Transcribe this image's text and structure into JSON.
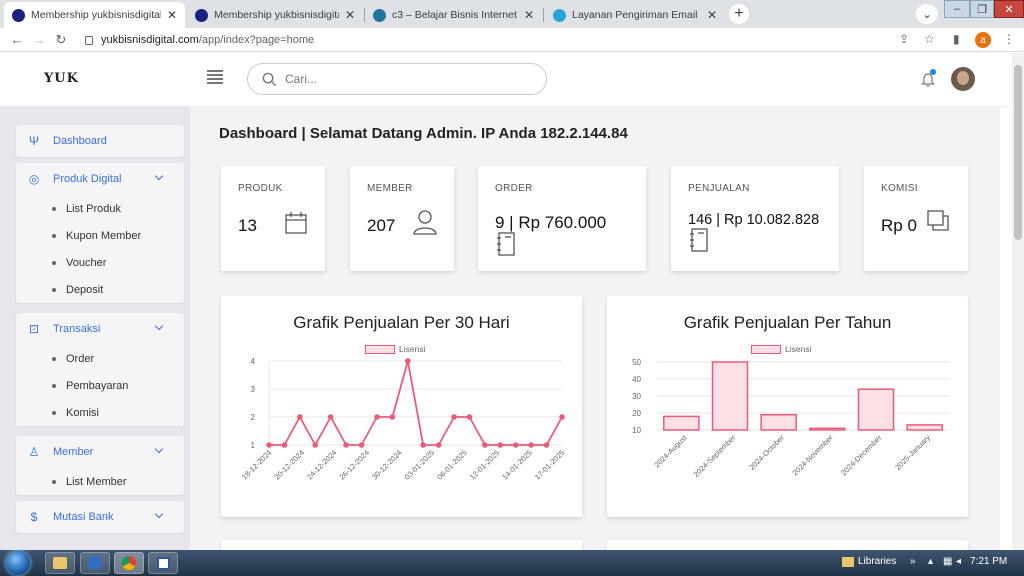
{
  "browser": {
    "tabs": [
      {
        "title": "Membership yukbisnisdigital.com",
        "color": "#1a237e",
        "glyph": "M"
      },
      {
        "title": "Membership yukbisnisdigital.com",
        "color": "#1a237e",
        "glyph": "M"
      },
      {
        "title": "c3 – Belajar Bisnis Internet",
        "color": "#21759b",
        "glyph": "W"
      },
      {
        "title": "Layanan Pengiriman Email Marke",
        "color": "#2aa3d9",
        "glyph": "➤"
      }
    ],
    "url_host": "yukbisnisdigital.com",
    "url_path": "/app/index?page=home",
    "profile_letter": "a"
  },
  "header": {
    "logo": "YUK",
    "search_placeholder": "Cari..."
  },
  "sidebar": {
    "dashboard": "Dashboard",
    "produk_digital": {
      "label": "Produk Digital",
      "items": [
        "List Produk",
        "Kupon Member",
        "Voucher",
        "Deposit"
      ]
    },
    "transaksi": {
      "label": "Transaksi",
      "items": [
        "Order",
        "Pembayaran",
        "Komisi"
      ]
    },
    "member": {
      "label": "Member",
      "items": [
        "List Member"
      ]
    },
    "mutasi_bank": "Mutasi Bank"
  },
  "main": {
    "title": "Dashboard | Selamat Datang Admin. IP Anda 182.2.144.84",
    "stats": {
      "produk": {
        "label": "PRODUK",
        "value": "13"
      },
      "member": {
        "label": "MEMBER",
        "value": "207"
      },
      "order": {
        "label": "ORDER",
        "value": "9 | Rp 760.000"
      },
      "penjualan": {
        "label": "PENJUALAN",
        "value": "146 | Rp 10.082.828"
      },
      "komisi": {
        "label": "KOMISI",
        "value": "Rp 0"
      }
    }
  },
  "chart_data": [
    {
      "type": "line",
      "title": "Grafik Penjualan Per 30 Hari",
      "series": [
        {
          "name": "Lisensi",
          "values": [
            1,
            1,
            2,
            1,
            2,
            1,
            1,
            2,
            2,
            4,
            1,
            1,
            2,
            2,
            1,
            1,
            1,
            1,
            1,
            2
          ]
        }
      ],
      "tick_labels": [
        "18-12-2024",
        "20-12-2024",
        "24-12-2024",
        "26-12-2024",
        "30-12-2024",
        "03-01-2025",
        "06-01-2025",
        "12-01-2025",
        "14-01-2025",
        "17-01-2025"
      ],
      "ylim": [
        1,
        4
      ],
      "yticks": [
        "1",
        "2",
        "3",
        "4"
      ],
      "color": "#ea5b7a",
      "legend": "top-center",
      "grid": true
    },
    {
      "type": "bar",
      "title": "Grafik Penjualan Per Tahun",
      "series": [
        {
          "name": "Lisensi",
          "values": [
            18,
            50,
            19,
            11,
            34,
            13
          ]
        }
      ],
      "categories": [
        "2024-August",
        "2024-September",
        "2024-October",
        "2024-November",
        "2024-December",
        "2025-January"
      ],
      "ylim": [
        10,
        50
      ],
      "yticks": [
        "10",
        "20",
        "30",
        "40",
        "50"
      ],
      "color": "#ea5b7a",
      "fill": "#fde0e6",
      "legend": "top-center",
      "grid": true
    }
  ],
  "taskbar": {
    "libraries": "Libraries",
    "time": "7:21 PM"
  }
}
